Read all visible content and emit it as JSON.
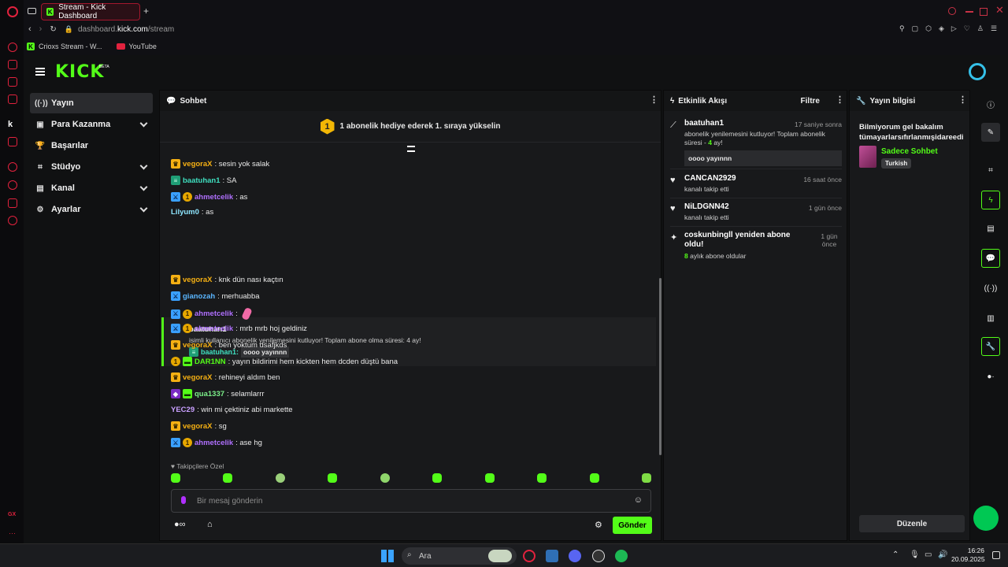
{
  "browser": {
    "tab_title": "Stream - Kick Dashboard",
    "url_prefix": "dashboard.",
    "url_host": "kick.com",
    "url_path": "/stream",
    "bookmarks": [
      "Crioxs Stream - W...",
      "YouTube"
    ]
  },
  "app": {
    "logo": "KICK",
    "beta": "BETA"
  },
  "nav": [
    {
      "label": "Yayın",
      "icon": "broadcast-icon",
      "active": true
    },
    {
      "label": "Para Kazanma",
      "icon": "money-icon"
    },
    {
      "label": "Başarılar",
      "icon": "trophy-icon"
    },
    {
      "label": "Stüdyo",
      "icon": "studio-icon"
    },
    {
      "label": "Kanal",
      "icon": "channel-icon"
    },
    {
      "label": "Ayarlar",
      "icon": "gear-icon"
    }
  ],
  "chat": {
    "title": "Sohbet",
    "gift_banner": "1 abonelik hediye ederek 1. sıraya yükselin",
    "gift_rank": "1",
    "messages": [
      {
        "user": "vegoraX",
        "text": ": sesin yok salak",
        "color": "#f5b013",
        "badges": [
          "crown"
        ]
      },
      {
        "user": "baatuhan1",
        "text": ": SA",
        "color": "#3fe0c0",
        "badges": [
          "verified"
        ]
      },
      {
        "user": "ahmetcelik",
        "text": ": as",
        "color": "#b070ff",
        "badges": [
          "mod",
          "sub"
        ]
      },
      {
        "user": "Lilyum0",
        "text": ": as",
        "color": "#8ee6ff",
        "badges": []
      },
      {
        "user": "vegoraX",
        "text": ": knk dün nası kaçtın",
        "color": "#f5b013",
        "badges": [
          "crown"
        ]
      },
      {
        "user": "gianozah",
        "text": ": merhuabba",
        "color": "#5ab6ff",
        "badges": [
          "mod"
        ]
      },
      {
        "user": "ahmetcelik",
        "text": ":",
        "color": "#b070ff",
        "badges": [
          "mod",
          "sub"
        ]
      },
      {
        "user": "ahmetcelik",
        "text": ": mrb mrb hoj geldiniz",
        "color": "#b070ff",
        "badges": [
          "mod",
          "sub"
        ]
      },
      {
        "user": "vegoraX",
        "text": ": ben yoktum dsafjkds",
        "color": "#f5b013",
        "badges": [
          "crown"
        ]
      },
      {
        "user": "DAR1NN",
        "text": ": yayın bildirimi hem kickten hem dcden düştü bana",
        "color": "#53fc18",
        "badges": [
          "sub",
          "gift"
        ]
      },
      {
        "user": "vegoraX",
        "text": ": rehineyi aldım ben",
        "color": "#f5b013",
        "badges": [
          "crown"
        ]
      },
      {
        "user": "qua1337",
        "text": ": selamlarrr",
        "color": "#7cf08a",
        "badges": [
          "vip",
          "gift"
        ]
      },
      {
        "user": "YEC29",
        "text": ": win mi çektiniz abi markette",
        "color": "#c9a0ff",
        "badges": []
      },
      {
        "user": "vegoraX",
        "text": ": sg",
        "color": "#f5b013",
        "badges": [
          "crown"
        ]
      },
      {
        "user": "ahmetcelik",
        "text": ": ase hg",
        "color": "#b070ff",
        "badges": [
          "mod",
          "sub"
        ]
      }
    ],
    "sub_card": {
      "user": "baatuhan1",
      "text": "isimli kullanıcı abonelik yenilemesini kutluyor! Toplam abone olma süresi: 4 ay!",
      "reply_user": "baatuhan1:",
      "reply_text": "oooo yayınnn"
    },
    "followers_only": "Takipçilere Özel",
    "input_placeholder": "Bir mesaj gönderin",
    "send_label": "Gönder"
  },
  "activity": {
    "title": "Etkinlik Akışı",
    "filter_label": "Filtre",
    "items": [
      {
        "name": "baatuhan1",
        "time": "17 saniye sonra",
        "desc_pre": "abonelik yenilemesini kutluyor! Toplam abonelik süresi - ",
        "desc_hl": "4",
        "desc_post": " ay!",
        "reply": "oooo yayınnn",
        "icon": "sparkle-icon"
      },
      {
        "name": "CANCAN2929",
        "time": "16 saat önce",
        "desc": "kanalı takip etti",
        "icon": "heart-icon"
      },
      {
        "name": "NiLDGNN42",
        "time": "1 gün önce",
        "desc": "kanalı takip etti",
        "icon": "heart-icon"
      },
      {
        "name": "coskunbingll yeniden abone oldu!",
        "time": "1 gün önce",
        "desc_hl": "8",
        "desc_post": " aylık abone oldular",
        "icon": "star-icon"
      }
    ]
  },
  "stream_info": {
    "title": "Yayın bilgisi",
    "stream_title": "Bilmiyorum gel bakalım tümayarlarsıfırlanmışidareedi",
    "category": "Sadece Sohbet",
    "tag": "Turkish",
    "edit_label": "Düzenle"
  },
  "taskbar": {
    "search_placeholder": "Ara",
    "time": "16:26",
    "date": "20.09.2025"
  },
  "colors": {
    "accent": "#53fc18",
    "opera": "#e2223e"
  }
}
